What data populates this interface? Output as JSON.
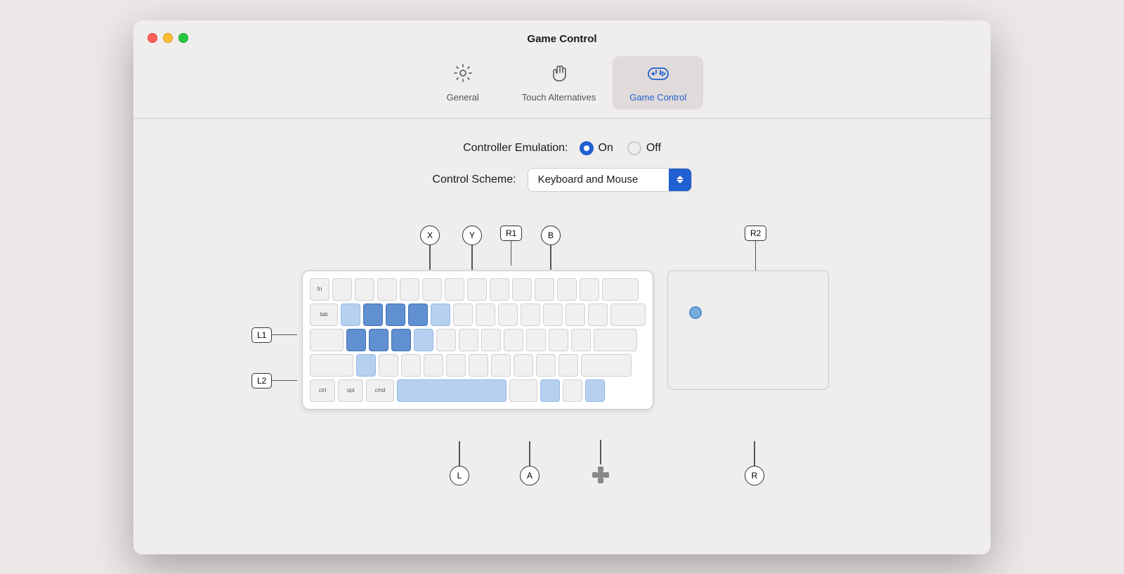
{
  "window": {
    "title": "Game Control"
  },
  "toolbar": {
    "items": [
      {
        "id": "general",
        "label": "General",
        "icon": "gear",
        "active": false
      },
      {
        "id": "touch",
        "label": "Touch Alternatives",
        "icon": "hand",
        "active": false
      },
      {
        "id": "gamecontrol",
        "label": "Game Control",
        "icon": "gamepad",
        "active": true
      }
    ]
  },
  "controller_emulation": {
    "label": "Controller Emulation:",
    "on_label": "On",
    "off_label": "Off",
    "selected": "on"
  },
  "control_scheme": {
    "label": "Control Scheme:",
    "value": "Keyboard and Mouse"
  },
  "buttons": {
    "x": "X",
    "y": "Y",
    "r1": "R1",
    "b": "B",
    "r2": "R2",
    "l1": "L1",
    "l2": "L2",
    "l": "L",
    "a": "A",
    "r": "R"
  },
  "traffic_lights": {
    "close": "close",
    "minimize": "minimize",
    "maximize": "maximize"
  }
}
